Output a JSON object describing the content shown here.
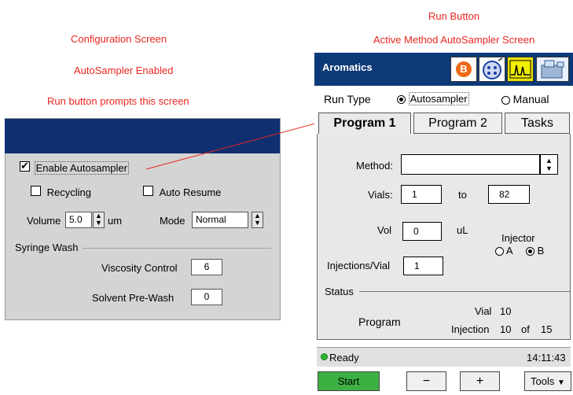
{
  "annotations": {
    "config_title": "Configuration Screen",
    "autosampler_enabled": "AutoSampler Enabled",
    "run_prompt": "Run button prompts this screen",
    "run_button": "Run Button",
    "active_method": "Active Method AutoSampler Screen"
  },
  "config": {
    "enable_autosampler": "Enable Autosampler",
    "recycling": "Recycling",
    "auto_resume": "Auto Resume",
    "volume_label": "Volume",
    "volume_value": "5.0",
    "volume_unit": "um",
    "mode_label": "Mode",
    "mode_value": "Normal",
    "syringe_wash": "Syringe Wash",
    "viscosity_label": "Viscosity Control",
    "viscosity_value": "6",
    "solvent_label": "Solvent Pre-Wash",
    "solvent_value": "0"
  },
  "device": {
    "title": "Aromatics",
    "run_type_label": "Run Type",
    "autosampler": "Autosampler",
    "manual": "Manual",
    "tabs": [
      "Program 1",
      "Program 2",
      "Tasks"
    ],
    "method_label": "Method:",
    "method_value": "",
    "vials_label": "Vials:",
    "vials_from": "1",
    "to_label": "to",
    "vials_to": "82",
    "vol_label": "Vol",
    "vol_value": "0",
    "vol_unit": "uL",
    "injector_label": "Injector",
    "injector_a": "A",
    "injector_b": "B",
    "injections_label": "Injections/Vial",
    "injections_value": "1",
    "status_label": "Status",
    "program_label": "Program",
    "vial_label": "Vial",
    "vial_value": "10",
    "injection_label": "Injection",
    "injection_value": "10",
    "of_label": "of",
    "injection_total": "15",
    "ready_text": "Ready",
    "time": "14:11:43",
    "start": "Start",
    "minus": "−",
    "plus": "+",
    "tools": "Tools"
  },
  "colors": {
    "header": "#0c3977",
    "config_bar": "#102f70",
    "start_button": "#3cb043",
    "ready_dot": "#2db52d",
    "annotation": "#e8261f"
  }
}
